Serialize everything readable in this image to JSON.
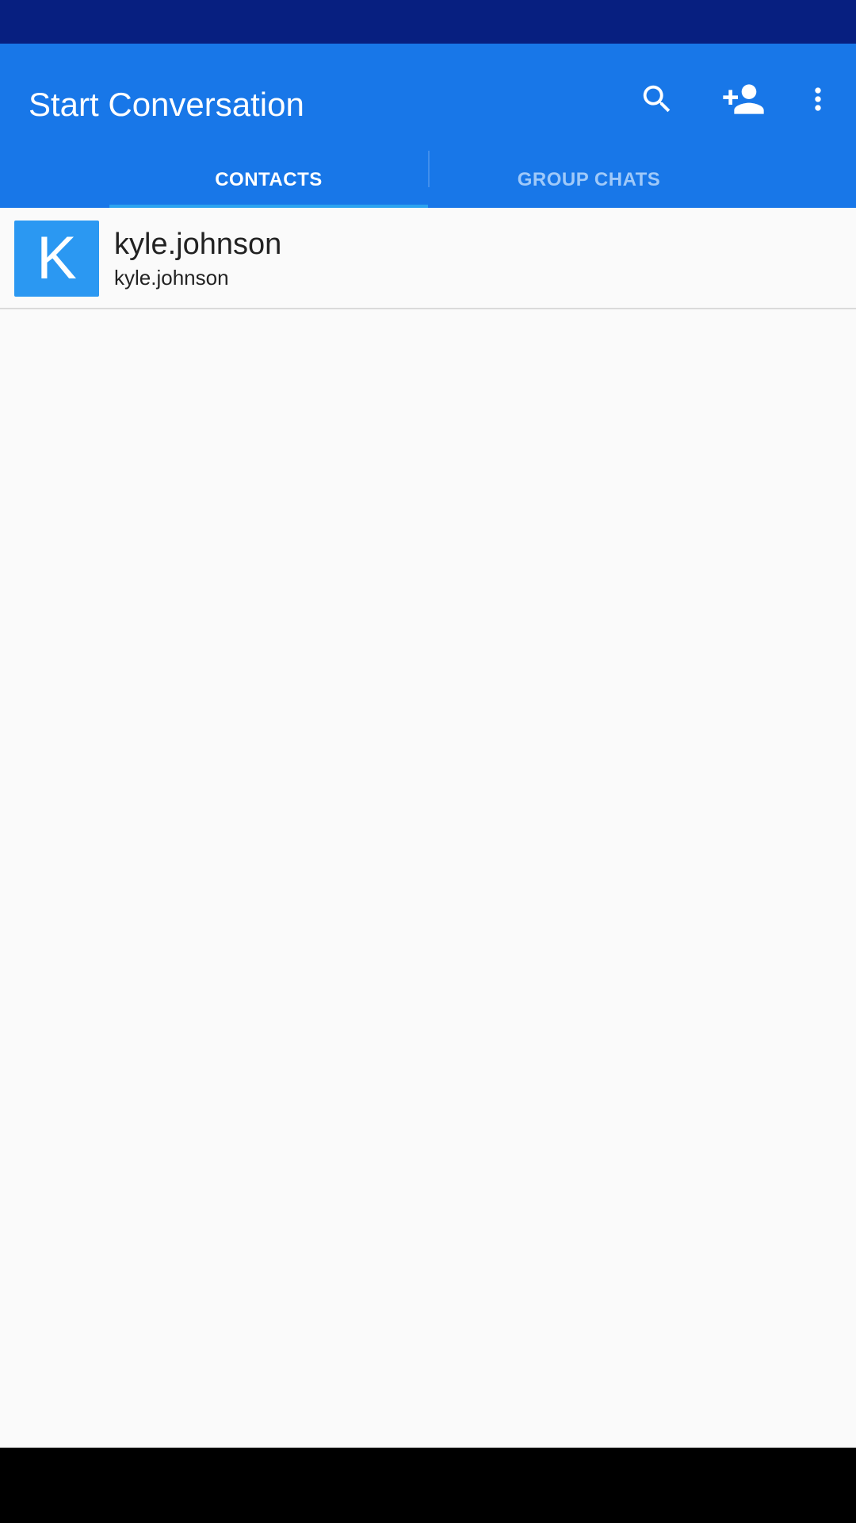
{
  "app_bar": {
    "title": "Start Conversation",
    "actions": [
      {
        "name": "search",
        "icon": "search-icon"
      },
      {
        "name": "add-contact",
        "icon": "person-add-icon"
      },
      {
        "name": "more-options",
        "icon": "more-vert-icon"
      }
    ]
  },
  "tabs": [
    {
      "label": "CONTACTS",
      "selected": true
    },
    {
      "label": "GROUP CHATS",
      "selected": false
    }
  ],
  "contacts": [
    {
      "initial": "K",
      "name": "kyle.johnson",
      "jid": "kyle.johnson",
      "avatar_color": "#2b98f2"
    }
  ],
  "colors": {
    "status_bar": "#071f80",
    "app_bar": "#1877e8",
    "tab_indicator": "#2ba3f0",
    "background": "#fafafa"
  }
}
